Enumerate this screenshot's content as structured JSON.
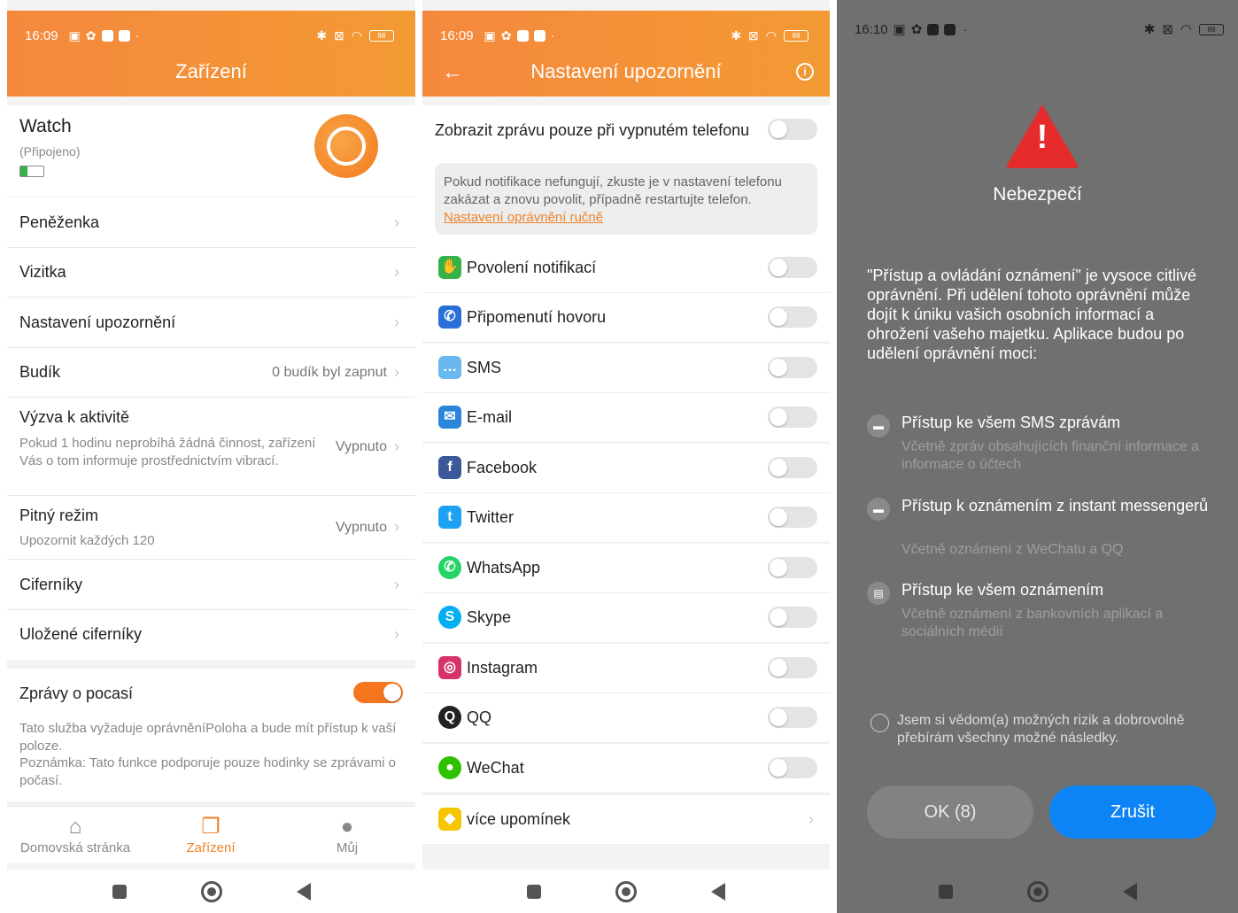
{
  "panel1": {
    "status_time": "16:09",
    "battery": "88",
    "title": "Zařízení",
    "device": {
      "name": "Watch",
      "state": "(Připojeno)"
    },
    "menu": [
      {
        "label": "Peněženka",
        "value": ""
      },
      {
        "label": "Vizitka",
        "value": ""
      },
      {
        "label": "Nastavení upozornění",
        "value": ""
      },
      {
        "label": "Budík",
        "value": "0 budík byl zapnut"
      }
    ],
    "activity": {
      "label": "Výzva k aktivitě",
      "desc": "Pokud 1 hodinu neprobíhá žádná činnost, zařízení Vás o tom informuje prostřednictvím vibrací.",
      "value": "Vypnuto"
    },
    "drink": {
      "label": "Pitný režim",
      "desc": "Upozornit každých 120",
      "value": "Vypnuto"
    },
    "menu2": [
      {
        "label": "Ciferníky"
      },
      {
        "label": "Uložené ciferníky"
      }
    ],
    "weather": {
      "label": "Zprávy o pocasí",
      "enabled": true,
      "desc1": "Tato služba vyžaduje oprávněníPoloha a bude mít přístup k vaší poloze.",
      "desc2": "Poznámka: Tato funkce podporuje pouze hodinky se zprávami o počasí."
    },
    "nav": [
      {
        "label": "Domovská stránka",
        "icon": "home-icon"
      },
      {
        "label": "Zařízení",
        "icon": "devices-icon"
      },
      {
        "label": "Můj",
        "icon": "user-icon"
      }
    ]
  },
  "panel2": {
    "status_time": "16:09",
    "battery": "88",
    "title": "Nastavení upozornění",
    "only_off_label": "Zobrazit zprávu pouze při vypnutém telefonu",
    "info_text": "Pokud notifikace nefungují, zkuste je v nastavení telefonu zakázat a znovu povolit, případně restartujte telefon.",
    "info_link": "Nastavení oprávnění ručně",
    "items": [
      {
        "label": "Povolení notifikací",
        "icon": "hand-icon",
        "color": "#35b24a",
        "glyph": "✋"
      },
      {
        "label": "Připomenutí hovoru",
        "icon": "phone-icon",
        "color": "#2a6fd8",
        "glyph": "✆"
      },
      {
        "label": "SMS",
        "icon": "sms-icon",
        "color": "#69b8f0",
        "glyph": "…"
      },
      {
        "label": "E-mail",
        "icon": "email-icon",
        "color": "#2a86d9",
        "glyph": "✉"
      },
      {
        "label": "Facebook",
        "icon": "facebook-icon",
        "color": "#3b5998",
        "glyph": "f"
      },
      {
        "label": "Twitter",
        "icon": "twitter-icon",
        "color": "#1da1f2",
        "glyph": "t"
      },
      {
        "label": "WhatsApp",
        "icon": "whatsapp-icon",
        "color": "#25d366",
        "glyph": "✆"
      },
      {
        "label": "Skype",
        "icon": "skype-icon",
        "color": "#00aff0",
        "glyph": "S"
      },
      {
        "label": "Instagram",
        "icon": "instagram-icon",
        "color": "#d6336c",
        "glyph": "◎"
      },
      {
        "label": "QQ",
        "icon": "qq-icon",
        "color": "#222222",
        "glyph": "Q"
      },
      {
        "label": "WeChat",
        "icon": "wechat-icon",
        "color": "#2dc100",
        "glyph": "●"
      }
    ],
    "more": {
      "label": "více upomínek",
      "icon": "more-icon",
      "color": "#f6c600"
    }
  },
  "panel3": {
    "status_time": "16:10",
    "battery": "88",
    "title": "Nebezpečí",
    "text": "\"Přístup a ovládání oznámení\" je vysoce citlivé oprávnění. Při udělení tohoto oprávnění může dojít k úniku vašich osobních informací a ohrožení vašeho majetku. Aplikace budou po udělení oprávnění moci:",
    "perms": [
      {
        "title": "Přístup ke všem SMS zprávám",
        "sub": "Včetně zpráv obsahujících finanční informace a informace o účtech"
      },
      {
        "title": "Přístup k oznámením z instant messengerů",
        "sub": "Včetně oznámení z WeChatu a QQ"
      },
      {
        "title": "Přístup ke všem oznámením",
        "sub": "Včetně oznámení z bankovních aplikací a sociálních médií"
      }
    ],
    "consent": "Jsem si vědom(a) možných rizik a dobrovolně přebírám všechny možné následky.",
    "ok_label": "OK (8)",
    "cancel_label": "Zrušit"
  }
}
